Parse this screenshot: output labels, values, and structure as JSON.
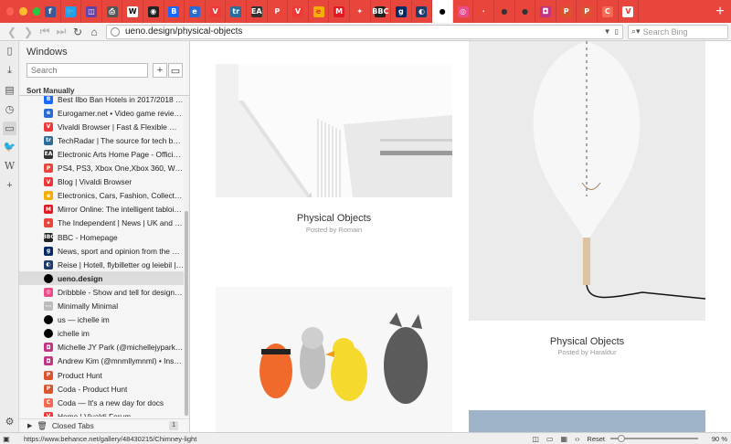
{
  "tabbar": {
    "tabs": [
      {
        "icon": "facebook-icon",
        "glyph": "f",
        "bg": "#3b5998",
        "color": "#ffffff"
      },
      {
        "icon": "twitter-icon",
        "glyph": "🐦",
        "bg": "#1da1f2",
        "color": "#ffffff"
      },
      {
        "icon": "twitch-icon",
        "glyph": "◫",
        "bg": "#6441a5",
        "color": "#ffffff"
      },
      {
        "icon": "printer-icon",
        "glyph": "⎙",
        "bg": "#555555",
        "color": "#ffffff"
      },
      {
        "icon": "wikipedia-icon",
        "glyph": "W",
        "bg": "#ffffff",
        "color": "#000000"
      },
      {
        "icon": "camera-icon",
        "glyph": "◉",
        "bg": "#222222",
        "color": "#ffffff"
      },
      {
        "icon": "behance-icon",
        "glyph": "B",
        "bg": "#1769ff",
        "color": "#ffffff"
      },
      {
        "icon": "eurogamer-icon",
        "glyph": "e",
        "bg": "#2a6ad3",
        "color": "#ffffff"
      },
      {
        "icon": "vivaldi-icon",
        "glyph": "V",
        "bg": "#ef3939",
        "color": "#ffffff"
      },
      {
        "icon": "techradar-icon",
        "glyph": "tr",
        "bg": "#2b6c9b",
        "color": "#ffffff"
      },
      {
        "icon": "ea-icon",
        "glyph": "EA",
        "bg": "#333333",
        "color": "#ffffff"
      },
      {
        "icon": "playstation-icon",
        "glyph": "P",
        "bg": "#e8453c",
        "color": "#ffffff"
      },
      {
        "icon": "vivaldi-blog-icon",
        "glyph": "V",
        "bg": "#ef3939",
        "color": "#ffffff"
      },
      {
        "icon": "ebay-icon",
        "glyph": "e",
        "bg": "#f5af02",
        "color": "#e53238"
      },
      {
        "icon": "mirror-icon",
        "glyph": "M",
        "bg": "#e01a22",
        "color": "#ffffff"
      },
      {
        "icon": "independent-icon",
        "glyph": "✦",
        "bg": "#e8453c",
        "color": "#ffffff"
      },
      {
        "icon": "bbc-icon",
        "glyph": "BBC",
        "bg": "#222222",
        "color": "#ffffff"
      },
      {
        "icon": "guardian-icon",
        "glyph": "g",
        "bg": "#052962",
        "color": "#ffffff"
      },
      {
        "icon": "norwegian-icon",
        "glyph": "◐",
        "bg": "#1d3b6b",
        "color": "#ffffff"
      },
      {
        "icon": "ueno-icon",
        "glyph": "●",
        "bg": "#ffffff",
        "color": "#000000"
      },
      {
        "icon": "dribbble-icon",
        "glyph": "◎",
        "bg": "#ea4c89",
        "color": "#ffffff"
      },
      {
        "icon": "minimally-minimal-icon",
        "glyph": "·",
        "bg": "#e8453c",
        "color": "#ffffff"
      },
      {
        "icon": "ichelle-icon",
        "glyph": "●",
        "bg": "#e8453c",
        "color": "#333333"
      },
      {
        "icon": "ichelle-im-icon",
        "glyph": "●",
        "bg": "#e8453c",
        "color": "#333333"
      },
      {
        "icon": "instagram-icon",
        "glyph": "◘",
        "bg": "#c13584",
        "color": "#ffffff"
      },
      {
        "icon": "producthunt-icon",
        "glyph": "P",
        "bg": "#da552f",
        "color": "#ffffff"
      },
      {
        "icon": "coda-icon",
        "glyph": "P",
        "bg": "#da552f",
        "color": "#ffffff"
      },
      {
        "icon": "coda-docs-icon",
        "glyph": "C",
        "bg": "#f46a54",
        "color": "#ffffff"
      },
      {
        "icon": "vivaldi-forum-icon",
        "glyph": "V",
        "bg": "#ffffff",
        "color": "#ef3939"
      }
    ],
    "active_index": 19,
    "new_tab_glyph": "+"
  },
  "addressbar": {
    "url": "ueno.design/physical-objects",
    "search_placeholder": "Search Bing"
  },
  "panel": {
    "title": "Windows",
    "search_placeholder": "Search",
    "sort_label": "Sort Manually",
    "items": [
      {
        "label": "Best Ilbo Ban Hotels in 2017/2018 - Get...",
        "icon": "behance-icon",
        "glyph": "B",
        "bg": "#1769ff"
      },
      {
        "label": "Eurogamer.net • Video game reviews...",
        "icon": "eurogamer-icon",
        "glyph": "e",
        "bg": "#2a6ad3"
      },
      {
        "label": "Vivaldi Browser | Fast & Flexible Web...",
        "icon": "vivaldi-icon",
        "glyph": "V",
        "bg": "#ef3939"
      },
      {
        "label": "TechRadar | The source for tech buyi...",
        "icon": "techradar-icon",
        "glyph": "tr",
        "bg": "#2b6c9b"
      },
      {
        "label": "Electronic Arts Home Page - Official ...",
        "icon": "ea-icon",
        "glyph": "EA",
        "bg": "#333333"
      },
      {
        "label": "PS4, PS3, Xbox One,Xbox 360, Wii, P...",
        "icon": "playstation-icon",
        "glyph": "P",
        "bg": "#e8453c"
      },
      {
        "label": "Blog | Vivaldi Browser",
        "icon": "vivaldi-blog-icon",
        "glyph": "V",
        "bg": "#ef3939"
      },
      {
        "label": "Electronics, Cars, Fashion, Collectibl...",
        "icon": "ebay-icon",
        "glyph": "e",
        "bg": "#f5af02"
      },
      {
        "label": "Mirror Online: The intelligent tabloid...",
        "icon": "mirror-icon",
        "glyph": "M",
        "bg": "#e01a22"
      },
      {
        "label": "The Independent | News | UK and W...",
        "icon": "independent-icon",
        "glyph": "✦",
        "bg": "#e8453c"
      },
      {
        "label": "BBC - Homepage",
        "icon": "bbc-icon",
        "glyph": "BBC",
        "bg": "#222222"
      },
      {
        "label": "News, sport and opinion from the Gu...",
        "icon": "guardian-icon",
        "glyph": "g",
        "bg": "#052962"
      },
      {
        "label": "Reise | Hotell, flybilletter og leiebil | ...",
        "icon": "norwegian-icon",
        "glyph": "◐",
        "bg": "#1d3b6b"
      },
      {
        "label": "ueno.design",
        "icon": "ueno-icon",
        "glyph": "●",
        "bg": "#000000"
      },
      {
        "label": "Dribbble - Show and tell for designers",
        "icon": "dribbble-icon",
        "glyph": "◎",
        "bg": "#ea4c89"
      },
      {
        "label": "Minimally Minimal",
        "icon": "minimally-minimal-icon",
        "glyph": "···",
        "bg": "#bbbbbb"
      },
      {
        "label": "us — ichelle im",
        "icon": "ichelle-icon",
        "glyph": "●",
        "bg": "#333333"
      },
      {
        "label": "ichelle im",
        "icon": "ichelle-im-icon",
        "glyph": "●",
        "bg": "#333333"
      },
      {
        "label": "Michelle JY Park (@michellejypark) • ...",
        "icon": "instagram-icon",
        "glyph": "◘",
        "bg": "#c13584"
      },
      {
        "label": "Andrew Kim (@mnmllymnml) • Insta...",
        "icon": "instagram-icon",
        "glyph": "◘",
        "bg": "#c13584"
      },
      {
        "label": "Product Hunt",
        "icon": "producthunt-icon",
        "glyph": "P",
        "bg": "#da552f"
      },
      {
        "label": "Coda - Product Hunt",
        "icon": "coda-icon",
        "glyph": "P",
        "bg": "#da552f"
      },
      {
        "label": "Coda — It's a new day for docs",
        "icon": "coda-docs-icon",
        "glyph": "C",
        "bg": "#f46a54"
      },
      {
        "label": "Home | Vivaldi Forum",
        "icon": "vivaldi-forum-icon",
        "glyph": "V",
        "bg": "#ef3939"
      }
    ],
    "selected_index": 13,
    "closed_tabs_label": "Closed Tabs",
    "closed_tabs_count": "1"
  },
  "content": {
    "cards": [
      {
        "title": "Physical Objects",
        "subtitle": "Posted by Romain"
      },
      {
        "title": "Physical Objects",
        "subtitle": "Posted by Haraldur"
      }
    ]
  },
  "statusbar": {
    "link": "https://www.behance.net/gallery/48430215/Chimney-light",
    "reset_label": "Reset",
    "zoom_value": "90 %",
    "zoom_level_percent": 90
  }
}
